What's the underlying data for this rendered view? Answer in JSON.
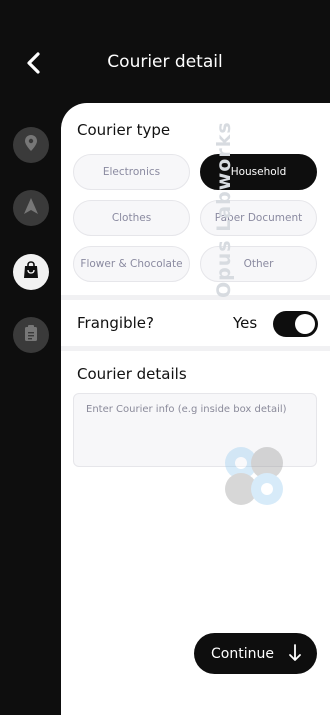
{
  "header": {
    "title": "Courier detail"
  },
  "rail": {
    "items": [
      {
        "icon": "location-pin-icon",
        "active": false
      },
      {
        "icon": "navigation-arrow-icon",
        "active": false
      },
      {
        "icon": "shopping-bag-icon",
        "active": true
      },
      {
        "icon": "clipboard-icon",
        "active": false
      }
    ]
  },
  "courier_type": {
    "title": "Courier type",
    "chips": [
      {
        "label": "Electronics",
        "selected": false
      },
      {
        "label": "Household",
        "selected": true
      },
      {
        "label": "Clothes",
        "selected": false
      },
      {
        "label": "Paper Document",
        "selected": false
      },
      {
        "label": "Flower & Chocolate",
        "selected": false
      },
      {
        "label": "Other",
        "selected": false
      }
    ]
  },
  "fragile": {
    "label": "Frangible?",
    "value_label": "Yes",
    "on": true
  },
  "details": {
    "title": "Courier details",
    "placeholder": "Enter Courier info (e.g inside box detail)",
    "value": ""
  },
  "watermark": {
    "text": "Opus Labworks"
  },
  "cta": {
    "label": "Continue"
  },
  "colors": {
    "background": "#0e0e0e",
    "sheet": "#ffffff",
    "chip_bg": "#f7f7f9",
    "chip_text": "#8a8aa0",
    "selected": "#0e0e0e"
  }
}
